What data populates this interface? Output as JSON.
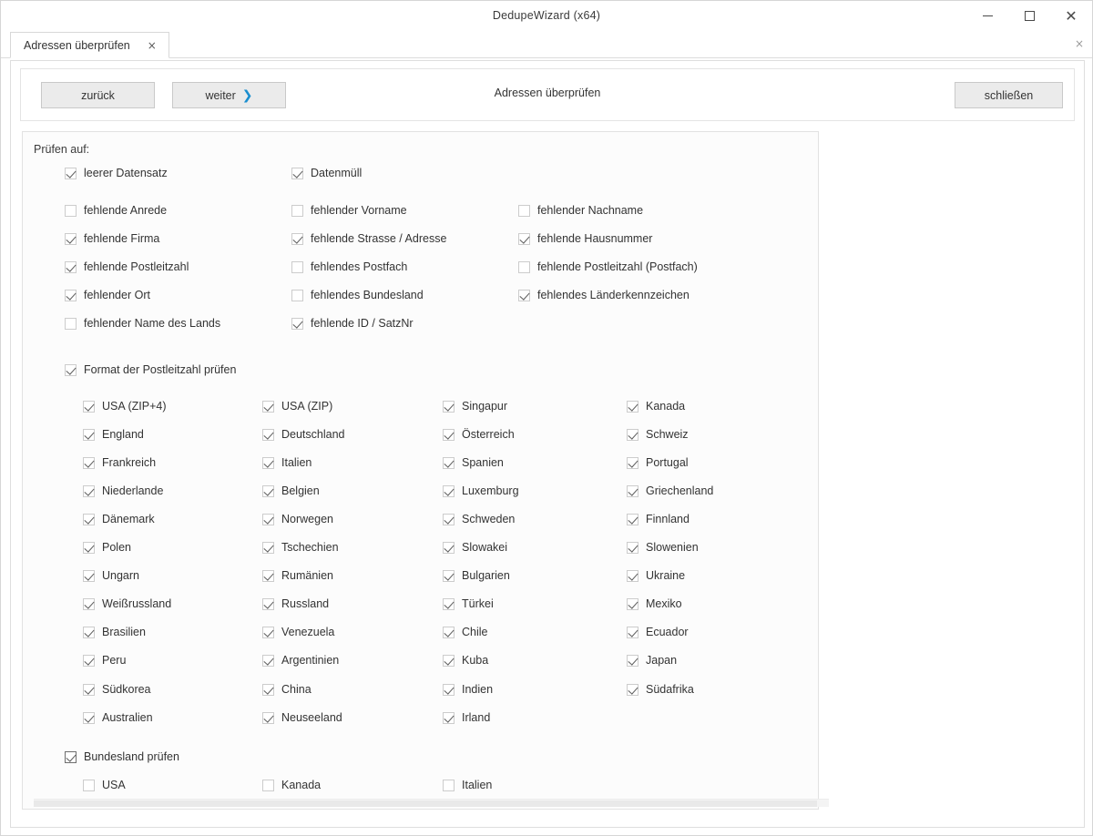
{
  "window": {
    "title": "DedupeWizard  (x64)",
    "controls": {
      "minimize": "minimize-icon",
      "maximize": "maximize-icon",
      "close": "close-icon"
    }
  },
  "tabs": {
    "items": [
      {
        "label": "Adressen überprüfen",
        "close": "×",
        "active": true
      }
    ],
    "strip_close": "×"
  },
  "toolbar": {
    "back_label": "zurück",
    "next_label": "weiter",
    "next_chevron": "❯",
    "title": "Adressen überprüfen",
    "close_label": "schließen"
  },
  "group": {
    "title": "Prüfen auf:"
  },
  "checks": {
    "top": [
      {
        "label": "leerer Datensatz",
        "checked": true,
        "col": 0,
        "row": 0
      },
      {
        "label": "Datenmüll",
        "checked": true,
        "col": 1,
        "row": 0
      },
      {
        "label": "fehlende Anrede",
        "checked": false,
        "col": 0,
        "row": 1
      },
      {
        "label": "fehlender Vorname",
        "checked": false,
        "col": 1,
        "row": 1
      },
      {
        "label": "fehlender Nachname",
        "checked": false,
        "col": 2,
        "row": 1
      },
      {
        "label": "fehlende Firma",
        "checked": true,
        "col": 0,
        "row": 2
      },
      {
        "label": "fehlende Strasse / Adresse",
        "checked": true,
        "col": 1,
        "row": 2
      },
      {
        "label": "fehlende Hausnummer",
        "checked": true,
        "col": 2,
        "row": 2
      },
      {
        "label": "fehlende Postleitzahl",
        "checked": true,
        "col": 0,
        "row": 3
      },
      {
        "label": "fehlendes Postfach",
        "checked": false,
        "col": 1,
        "row": 3
      },
      {
        "label": "fehlende Postleitzahl (Postfach)",
        "checked": false,
        "col": 2,
        "row": 3
      },
      {
        "label": "fehlender Ort",
        "checked": true,
        "col": 0,
        "row": 4
      },
      {
        "label": "fehlendes Bundesland",
        "checked": false,
        "col": 1,
        "row": 4
      },
      {
        "label": "fehlendes Länderkennzeichen",
        "checked": true,
        "col": 2,
        "row": 4
      },
      {
        "label": "fehlender Name des Lands",
        "checked": false,
        "col": 0,
        "row": 5
      },
      {
        "label": "fehlende ID / SatzNr",
        "checked": true,
        "col": 1,
        "row": 5
      }
    ],
    "zip_format": {
      "label": "Format der Postleitzahl prüfen",
      "checked": true,
      "countries": [
        {
          "label": "USA (ZIP+4)",
          "checked": true,
          "col": 0,
          "row": 0
        },
        {
          "label": "USA (ZIP)",
          "checked": true,
          "col": 1,
          "row": 0
        },
        {
          "label": "Singapur",
          "checked": true,
          "col": 2,
          "row": 0
        },
        {
          "label": "Kanada",
          "checked": true,
          "col": 3,
          "row": 0
        },
        {
          "label": "England",
          "checked": true,
          "col": 0,
          "row": 1
        },
        {
          "label": "Deutschland",
          "checked": true,
          "col": 1,
          "row": 1
        },
        {
          "label": "Österreich",
          "checked": true,
          "col": 2,
          "row": 1
        },
        {
          "label": "Schweiz",
          "checked": true,
          "col": 3,
          "row": 1
        },
        {
          "label": "Frankreich",
          "checked": true,
          "col": 0,
          "row": 2
        },
        {
          "label": "Italien",
          "checked": true,
          "col": 1,
          "row": 2
        },
        {
          "label": "Spanien",
          "checked": true,
          "col": 2,
          "row": 2
        },
        {
          "label": "Portugal",
          "checked": true,
          "col": 3,
          "row": 2
        },
        {
          "label": "Niederlande",
          "checked": true,
          "col": 0,
          "row": 3
        },
        {
          "label": "Belgien",
          "checked": true,
          "col": 1,
          "row": 3
        },
        {
          "label": "Luxemburg",
          "checked": true,
          "col": 2,
          "row": 3
        },
        {
          "label": "Griechenland",
          "checked": true,
          "col": 3,
          "row": 3
        },
        {
          "label": "Dänemark",
          "checked": true,
          "col": 0,
          "row": 4
        },
        {
          "label": "Norwegen",
          "checked": true,
          "col": 1,
          "row": 4
        },
        {
          "label": "Schweden",
          "checked": true,
          "col": 2,
          "row": 4
        },
        {
          "label": "Finnland",
          "checked": true,
          "col": 3,
          "row": 4
        },
        {
          "label": "Polen",
          "checked": true,
          "col": 0,
          "row": 5
        },
        {
          "label": "Tschechien",
          "checked": true,
          "col": 1,
          "row": 5
        },
        {
          "label": "Slowakei",
          "checked": true,
          "col": 2,
          "row": 5
        },
        {
          "label": "Slowenien",
          "checked": true,
          "col": 3,
          "row": 5
        },
        {
          "label": "Ungarn",
          "checked": true,
          "col": 0,
          "row": 6
        },
        {
          "label": "Rumänien",
          "checked": true,
          "col": 1,
          "row": 6
        },
        {
          "label": "Bulgarien",
          "checked": true,
          "col": 2,
          "row": 6
        },
        {
          "label": "Ukraine",
          "checked": true,
          "col": 3,
          "row": 6
        },
        {
          "label": "Weißrussland",
          "checked": true,
          "col": 0,
          "row": 7
        },
        {
          "label": "Russland",
          "checked": true,
          "col": 1,
          "row": 7
        },
        {
          "label": "Türkei",
          "checked": true,
          "col": 2,
          "row": 7
        },
        {
          "label": "Mexiko",
          "checked": true,
          "col": 3,
          "row": 7
        },
        {
          "label": "Brasilien",
          "checked": true,
          "col": 0,
          "row": 8
        },
        {
          "label": "Venezuela",
          "checked": true,
          "col": 1,
          "row": 8
        },
        {
          "label": "Chile",
          "checked": true,
          "col": 2,
          "row": 8
        },
        {
          "label": "Ecuador",
          "checked": true,
          "col": 3,
          "row": 8
        },
        {
          "label": "Peru",
          "checked": true,
          "col": 0,
          "row": 9
        },
        {
          "label": "Argentinien",
          "checked": true,
          "col": 1,
          "row": 9
        },
        {
          "label": "Kuba",
          "checked": true,
          "col": 2,
          "row": 9
        },
        {
          "label": "Japan",
          "checked": true,
          "col": 3,
          "row": 9
        },
        {
          "label": "Südkorea",
          "checked": true,
          "col": 0,
          "row": 10
        },
        {
          "label": "China",
          "checked": true,
          "col": 1,
          "row": 10
        },
        {
          "label": "Indien",
          "checked": true,
          "col": 2,
          "row": 10
        },
        {
          "label": "Südafrika",
          "checked": true,
          "col": 3,
          "row": 10
        },
        {
          "label": "Australien",
          "checked": true,
          "col": 0,
          "row": 11
        },
        {
          "label": "Neuseeland",
          "checked": true,
          "col": 1,
          "row": 11
        },
        {
          "label": "Irland",
          "checked": true,
          "col": 2,
          "row": 11
        }
      ]
    },
    "state_check": {
      "label": "Bundesland prüfen",
      "checked": true,
      "focused": true,
      "countries": [
        {
          "label": "USA",
          "checked": false,
          "col": 0,
          "row": 0
        },
        {
          "label": "Kanada",
          "checked": false,
          "col": 1,
          "row": 0
        },
        {
          "label": "Italien",
          "checked": false,
          "col": 2,
          "row": 0
        }
      ]
    }
  },
  "colors": {
    "accent": "#1a8ecf",
    "button_face": "#ebebeb",
    "text": "#333333",
    "panel_border": "#e2e2e2"
  }
}
